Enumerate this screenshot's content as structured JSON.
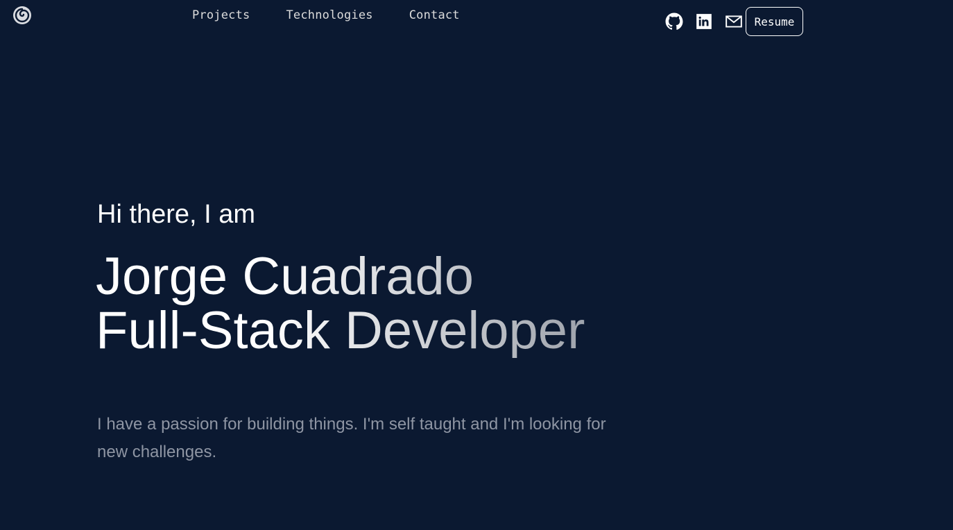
{
  "header": {
    "logo_icon": "spiral-logo-icon",
    "nav": [
      {
        "label": "Projects"
      },
      {
        "label": "Technologies"
      },
      {
        "label": "Contact"
      }
    ],
    "social": [
      {
        "icon": "github-icon"
      },
      {
        "icon": "linkedin-icon"
      },
      {
        "icon": "mail-icon"
      }
    ],
    "resume_label": "Resume"
  },
  "hero": {
    "greeting": "Hi there, I am",
    "name": "Jorge Cuadrado",
    "role": "Full-Stack Developer",
    "tagline": "I have a passion for building things. I'm self taught and I'm looking for new challenges."
  },
  "colors": {
    "background": "#0b1931",
    "text": "#ffffff",
    "muted": "#8e95a3"
  }
}
